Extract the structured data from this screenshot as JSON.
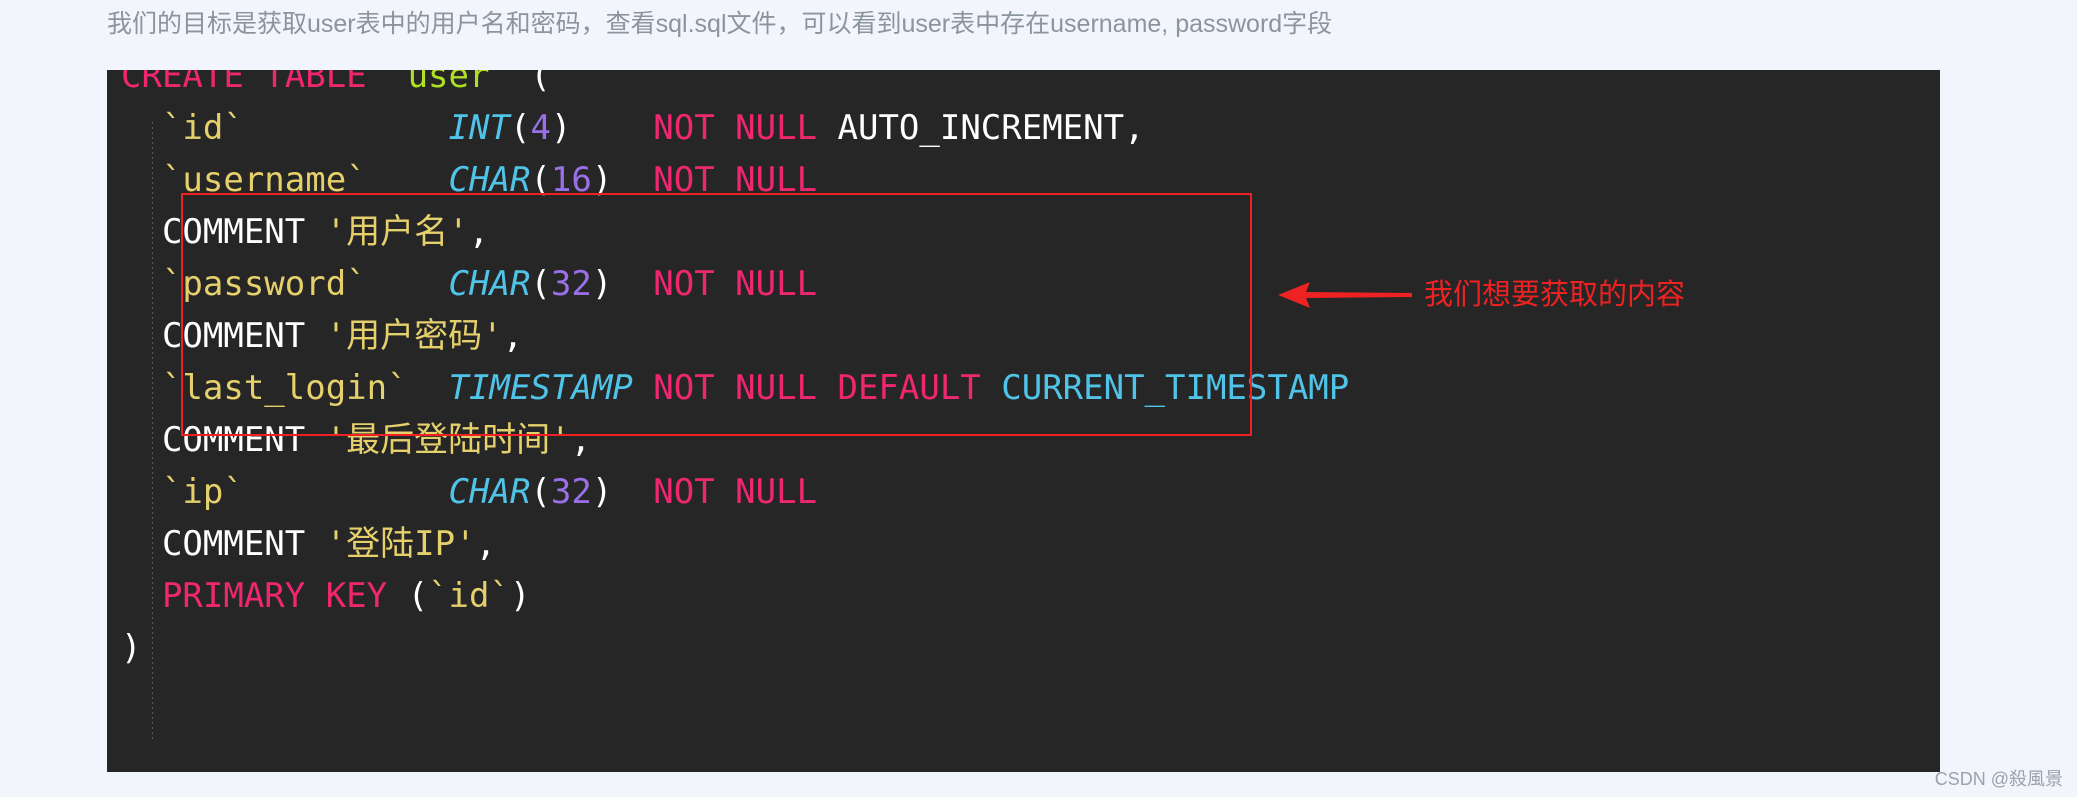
{
  "caption": {
    "text": "我们的目标是获取user表中的用户名和密码，查看sql.sql文件，可以看到user表中存在username, password字段"
  },
  "code_block": {
    "language": "sql",
    "background": "#262626",
    "lines": [
      {
        "id": "line-create",
        "tokens": [
          {
            "cls": "kw",
            "t": "CREATE TABLE "
          },
          {
            "cls": "tbl",
            "t": "`user`"
          },
          {
            "cls": "pl",
            "t": " ("
          }
        ]
      },
      {
        "id": "line-id",
        "tokens": [
          {
            "cls": "col",
            "t": "  `id`"
          },
          {
            "cls": "pl",
            "t": "          "
          },
          {
            "cls": "type",
            "t": "INT"
          },
          {
            "cls": "pl",
            "t": "("
          },
          {
            "cls": "num",
            "t": "4"
          },
          {
            "cls": "pl",
            "t": ")    "
          },
          {
            "cls": "kw",
            "t": "NOT NULL"
          },
          {
            "cls": "pl",
            "t": " AUTO_INCREMENT,"
          }
        ]
      },
      {
        "id": "line-username",
        "tokens": [
          {
            "cls": "col",
            "t": "  `username`"
          },
          {
            "cls": "pl",
            "t": "    "
          },
          {
            "cls": "type",
            "t": "CHAR"
          },
          {
            "cls": "pl",
            "t": "("
          },
          {
            "cls": "num",
            "t": "16"
          },
          {
            "cls": "pl",
            "t": ")  "
          },
          {
            "cls": "kw",
            "t": "NOT NULL"
          }
        ]
      },
      {
        "id": "line-username-comment",
        "tokens": [
          {
            "cls": "pl",
            "t": "  COMMENT "
          },
          {
            "cls": "col",
            "t": "'用户名'"
          },
          {
            "cls": "pl",
            "t": ","
          }
        ]
      },
      {
        "id": "line-password",
        "tokens": [
          {
            "cls": "col",
            "t": "  `password`"
          },
          {
            "cls": "pl",
            "t": "    "
          },
          {
            "cls": "type",
            "t": "CHAR"
          },
          {
            "cls": "pl",
            "t": "("
          },
          {
            "cls": "num",
            "t": "32"
          },
          {
            "cls": "pl",
            "t": ")  "
          },
          {
            "cls": "kw",
            "t": "NOT NULL"
          }
        ]
      },
      {
        "id": "line-password-comment",
        "tokens": [
          {
            "cls": "pl",
            "t": "  COMMENT "
          },
          {
            "cls": "col",
            "t": "'用户密码'"
          },
          {
            "cls": "pl",
            "t": ","
          }
        ]
      },
      {
        "id": "line-last-login",
        "tokens": [
          {
            "cls": "col",
            "t": "  `last_login`"
          },
          {
            "cls": "pl",
            "t": "  "
          },
          {
            "cls": "type",
            "t": "TIMESTAMP"
          },
          {
            "cls": "pl",
            "t": " "
          },
          {
            "cls": "kw",
            "t": "NOT NULL DEFAULT"
          },
          {
            "cls": "pl",
            "t": " "
          },
          {
            "cls": "type-ni",
            "t": "CURRENT_TIMESTAMP"
          }
        ]
      },
      {
        "id": "line-last-login-comment",
        "tokens": [
          {
            "cls": "pl",
            "t": "  COMMENT "
          },
          {
            "cls": "col",
            "t": "'最后登陆时间'"
          },
          {
            "cls": "pl",
            "t": ","
          }
        ]
      },
      {
        "id": "line-ip",
        "tokens": [
          {
            "cls": "col",
            "t": "  `ip`"
          },
          {
            "cls": "pl",
            "t": "          "
          },
          {
            "cls": "type",
            "t": "CHAR"
          },
          {
            "cls": "pl",
            "t": "("
          },
          {
            "cls": "num",
            "t": "32"
          },
          {
            "cls": "pl",
            "t": ")  "
          },
          {
            "cls": "kw",
            "t": "NOT NULL"
          }
        ]
      },
      {
        "id": "line-ip-comment",
        "tokens": [
          {
            "cls": "pl",
            "t": "  COMMENT "
          },
          {
            "cls": "col",
            "t": "'登陆IP'"
          },
          {
            "cls": "pl",
            "t": ","
          }
        ]
      },
      {
        "id": "line-primary-key",
        "tokens": [
          {
            "cls": "kw",
            "t": "  PRIMARY KEY"
          },
          {
            "cls": "pl",
            "t": " ("
          },
          {
            "cls": "col",
            "t": "`id`"
          },
          {
            "cls": "pl",
            "t": ")"
          }
        ]
      },
      {
        "id": "line-close-paren",
        "tokens": [
          {
            "cls": "pl",
            "t": ")"
          }
        ]
      }
    ]
  },
  "annotation": {
    "box_color": "#ee2222",
    "arrow_color": "#ee2222",
    "note": "我们想要获取的内容"
  },
  "watermark": {
    "text": "CSDN @殺風景"
  }
}
